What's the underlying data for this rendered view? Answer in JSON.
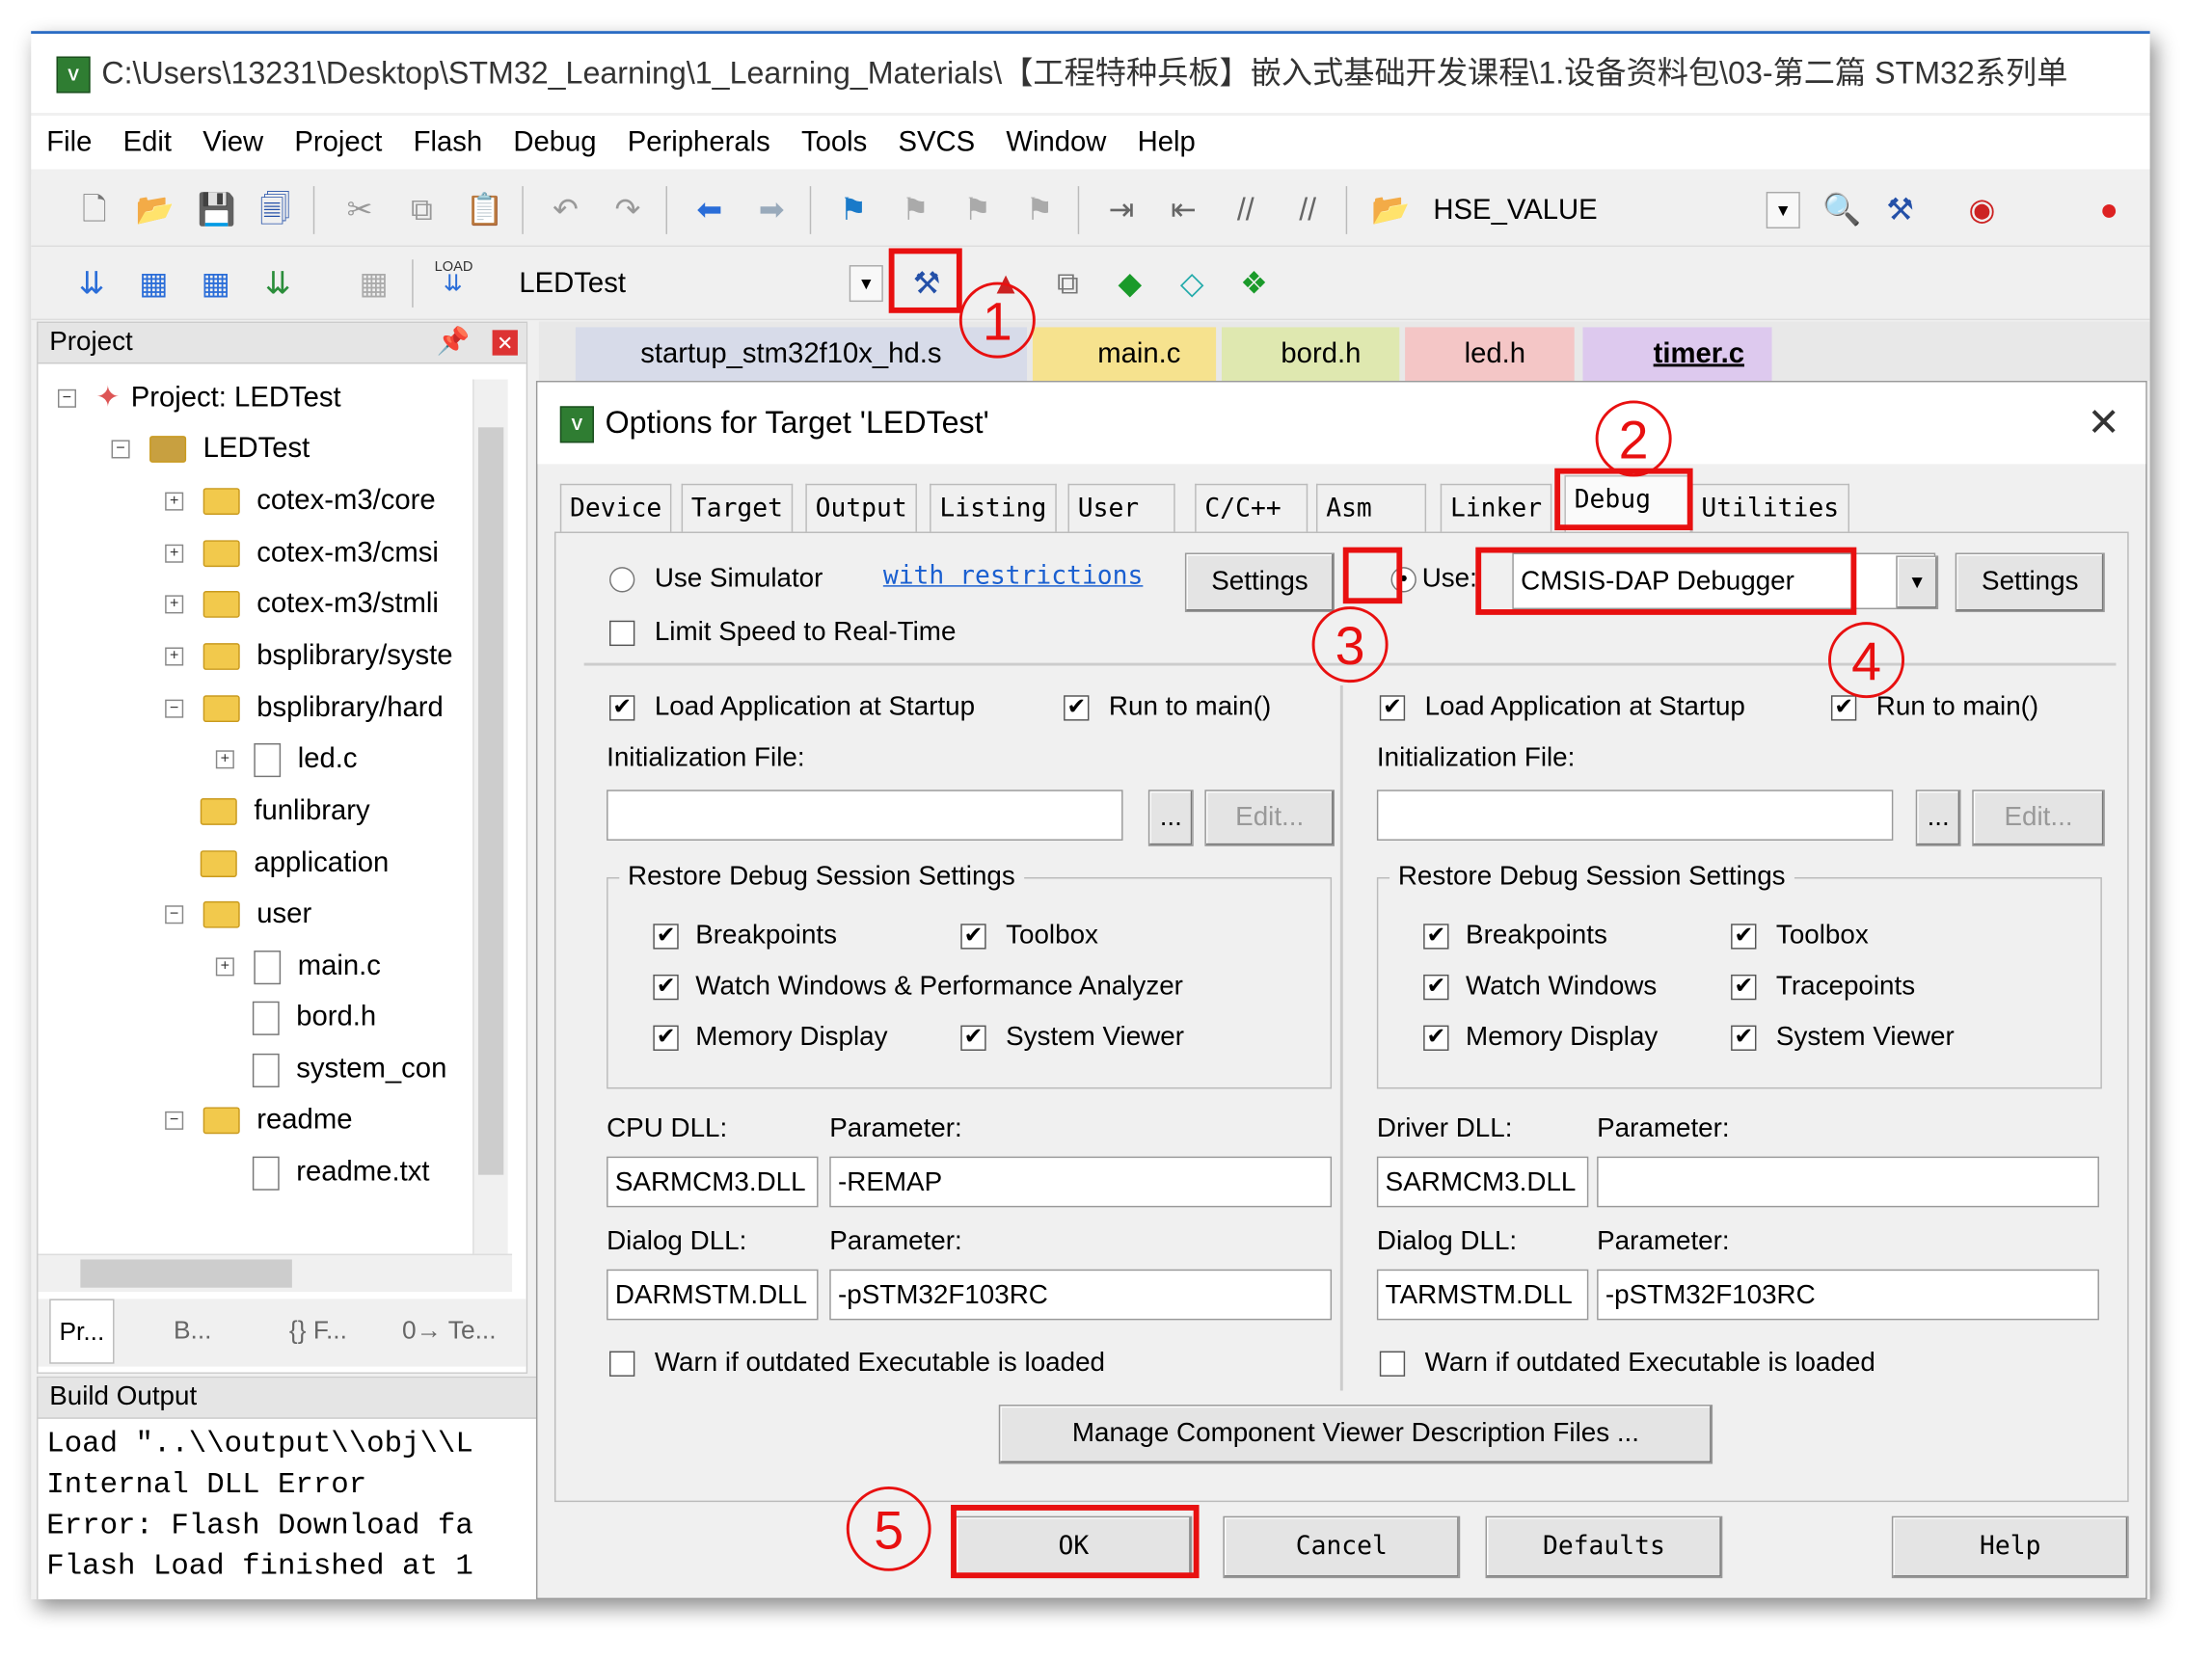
{
  "window": {
    "title": "C:\\Users\\13231\\Desktop\\STM32_Learning\\1_Learning_Materials\\【工程特种兵板】嵌入式基础开发课程\\1.设备资料包\\03-第二篇 STM32系列单"
  },
  "menu": [
    "File",
    "Edit",
    "View",
    "Project",
    "Flash",
    "Debug",
    "Peripherals",
    "Tools",
    "SVCS",
    "Window",
    "Help"
  ],
  "toolbar": {
    "find_value": "HSE_VALUE",
    "target": "LEDTest",
    "load_label": "LOAD"
  },
  "project_panel": {
    "title": "Project",
    "tree": [
      "Project: LEDTest",
      "LEDTest",
      "cotex-m3/core",
      "cotex-m3/cmsi",
      "cotex-m3/stmli",
      "bsplibrary/syste",
      "bsplibrary/hard",
      "led.c",
      "funlibrary",
      "application",
      "user",
      "main.c",
      "bord.h",
      "system_con",
      "readme",
      "readme.txt"
    ],
    "bottom_tabs": [
      "Pr...",
      "B...",
      "{} F...",
      "0→ Te..."
    ]
  },
  "editor_tabs": [
    "startup_stm32f10x_hd.s",
    "main.c",
    "bord.h",
    "led.h",
    "timer.c"
  ],
  "build_output": {
    "title": "Build Output",
    "lines": [
      "Load \"..\\\\output\\\\obj\\\\L",
      "Internal DLL Error",
      "Error: Flash Download fa",
      "Flash Load finished at 1"
    ]
  },
  "dialog": {
    "title": "Options for Target 'LEDTest'",
    "tabs": [
      "Device",
      "Target",
      "Output",
      "Listing",
      "User",
      "C/C++",
      "Asm",
      "Linker",
      "Debug",
      "Utilities"
    ],
    "active_tab": "Debug",
    "left": {
      "use_simulator": "Use Simulator",
      "restrictions_link": "with restrictions",
      "settings": "Settings",
      "limit_speed": "Limit Speed to Real-Time",
      "load_app": "Load Application at Startup",
      "run_main": "Run to main()",
      "init_file": "Initialization File:",
      "browse": "...",
      "edit": "Edit...",
      "restore": "Restore Debug Session Settings",
      "breakpoints": "Breakpoints",
      "toolbox": "Toolbox",
      "watch": "Watch Windows & Performance Analyzer",
      "memory": "Memory Display",
      "sysviewer": "System Viewer",
      "cpu_dll": "CPU DLL:",
      "param": "Parameter:",
      "cpu_dll_value": "SARMCM3.DLL",
      "cpu_param_value": "-REMAP",
      "dialog_dll": "Dialog DLL:",
      "dialog_dll_value": "DARMSTM.DLL",
      "dialog_param_value": "-pSTM32F103RC",
      "warn": "Warn if outdated Executable is loaded"
    },
    "right": {
      "use": "Use:",
      "debugger": "CMSIS-DAP Debugger",
      "settings": "Settings",
      "load_app": "Load Application at Startup",
      "run_main": "Run to main()",
      "init_file": "Initialization File:",
      "browse": "...",
      "edit": "Edit...",
      "restore": "Restore Debug Session Settings",
      "breakpoints": "Breakpoints",
      "toolbox": "Toolbox",
      "watch": "Watch Windows",
      "tracepoints": "Tracepoints",
      "memory": "Memory Display",
      "sysviewer": "System Viewer",
      "driver_dll": "Driver DLL:",
      "param": "Parameter:",
      "driver_dll_value": "SARMCM3.DLL",
      "driver_param_value": "",
      "dialog_dll": "Dialog DLL:",
      "dialog_dll_value": "TARMSTM.DLL",
      "dialog_param_value": "-pSTM32F103RC",
      "warn": "Warn if outdated Executable is loaded"
    },
    "manage": "Manage Component Viewer Description Files ...",
    "buttons": {
      "ok": "OK",
      "cancel": "Cancel",
      "defaults": "Defaults",
      "help": "Help"
    }
  },
  "annotations": [
    "1",
    "2",
    "3",
    "4",
    "5"
  ],
  "colors": {
    "annotation": "#e81010",
    "link": "#1a5fd0"
  }
}
